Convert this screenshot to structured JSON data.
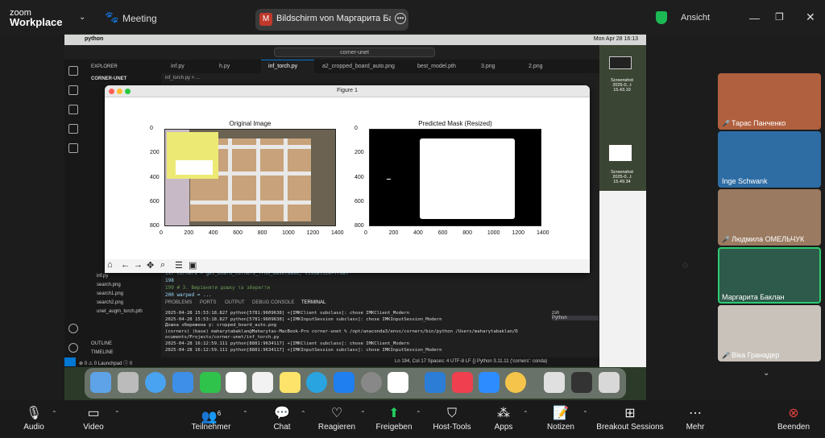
{
  "topbar": {
    "brand_line1": "zoom",
    "brand_line2": "Workplace",
    "meeting_label": "Meeting",
    "share_initial": "M",
    "share_label": "Bildschirm von Маргарита Баклан",
    "view_label": "Ansicht"
  },
  "mac_menubar": {
    "app": "python",
    "datetime": "Mon Apr 28  16:13"
  },
  "vscode": {
    "command_center": "corner-unet",
    "explorer_title": "EXPLORER",
    "project_title": "CORNER-UNET",
    "breadcrumb": "inf_torch.py > ...",
    "tabs": [
      "inf.py",
      "h.py",
      "inf_torch.py",
      "a2_cropped_board_auto.png",
      "best_model.pth",
      "3.png",
      "2.png"
    ],
    "files": [
      "inf.py",
      "search.png",
      "search1.png",
      "search2.png",
      "unet_augm_torch.pth"
    ],
    "outline_label": "OUTLINE",
    "timeline_label": "TIMELINE",
    "code_lines": [
      "197    corners = get_board_corners_from_mask(mask, visualize=True)",
      "198",
      "199    # 3. Вирівняти дошку та зберегти",
      "200    warped = ..."
    ],
    "panel_tabs": [
      "PROBLEMS",
      "PORTS",
      "OUTPUT",
      "DEBUG CONSOLE",
      "TERMINAL"
    ],
    "terminal_lines": [
      "2025-04-28 15:53:18.827 python[5781:9609638] +[IMKClient subclass]: chose IMKClient_Modern",
      "2025-04-28 15:53:18.827 python[5781:9609638] +[IMKInputSession subclass]: chose IMKInputSession_Modern",
      "Дошка збережена у: cropped_board_auto.png",
      "(corners) (base) maharytabaklan@Maharytas-MacBook-Pro corner-unet % /opt/anaconda3/envs/corners/bin/python /Users/maharytabaklan/D",
      "ocuments/Projects/corner-unet/inf_torch.py",
      "2025-04-28 16:12:59.111 python[8881:9634117] +[IMKClient subclass]: chose IMKClient_Modern",
      "2025-04-28 16:12:59.111 python[8881:9634117] +[IMKInputSession subclass]: chose IMKInputSession_Modern"
    ],
    "terminal_list": [
      "zsh",
      "Python"
    ],
    "status_left": "⊗ 0 ⚠ 0   Launchpad   ⓘ 0",
    "status_right": "Ln 194, Col 17   Spaces: 4   UTF-8   LF   {} Python   3.11.11 ('corners': conda)"
  },
  "figure": {
    "window_title": "Figure 1",
    "left_title": "Original Image",
    "right_title": "Predicted Mask (Resized)",
    "x_ticks": [
      "0",
      "200",
      "400",
      "600",
      "800",
      "1000",
      "1200",
      "1400"
    ],
    "y_ticks": [
      "0",
      "200",
      "400",
      "600",
      "800"
    ]
  },
  "desktop": {
    "screenshot1": "Screenshot 2025-0...t 15.43.10",
    "screenshot2": "Screenshot 2025-0...t 15.49.34"
  },
  "participants": [
    {
      "name": "Тарас Панченко",
      "muted": true
    },
    {
      "name": "Inge Schwank",
      "muted": false
    },
    {
      "name": "Людмила ОМЕЛЬЧУК",
      "muted": true
    },
    {
      "name": "Маргарита Баклан",
      "muted": false
    },
    {
      "name": "Віка Гранадер",
      "muted": true
    }
  ],
  "toolbar": {
    "audio": "Audio",
    "video": "Video",
    "participants": "Teilnehmer",
    "participants_count": "6",
    "chat": "Chat",
    "reactions": "Reagieren",
    "share": "Freigeben",
    "host_tools": "Host-Tools",
    "apps": "Apps",
    "notes": "Notizen",
    "breakout": "Breakout Sessions",
    "more": "Mehr",
    "end": "Beenden"
  },
  "colors": {
    "share_green": "#23d160",
    "end_red": "#e34040",
    "active_border": "#2ecc71",
    "vscode_accent": "#0078d4"
  }
}
